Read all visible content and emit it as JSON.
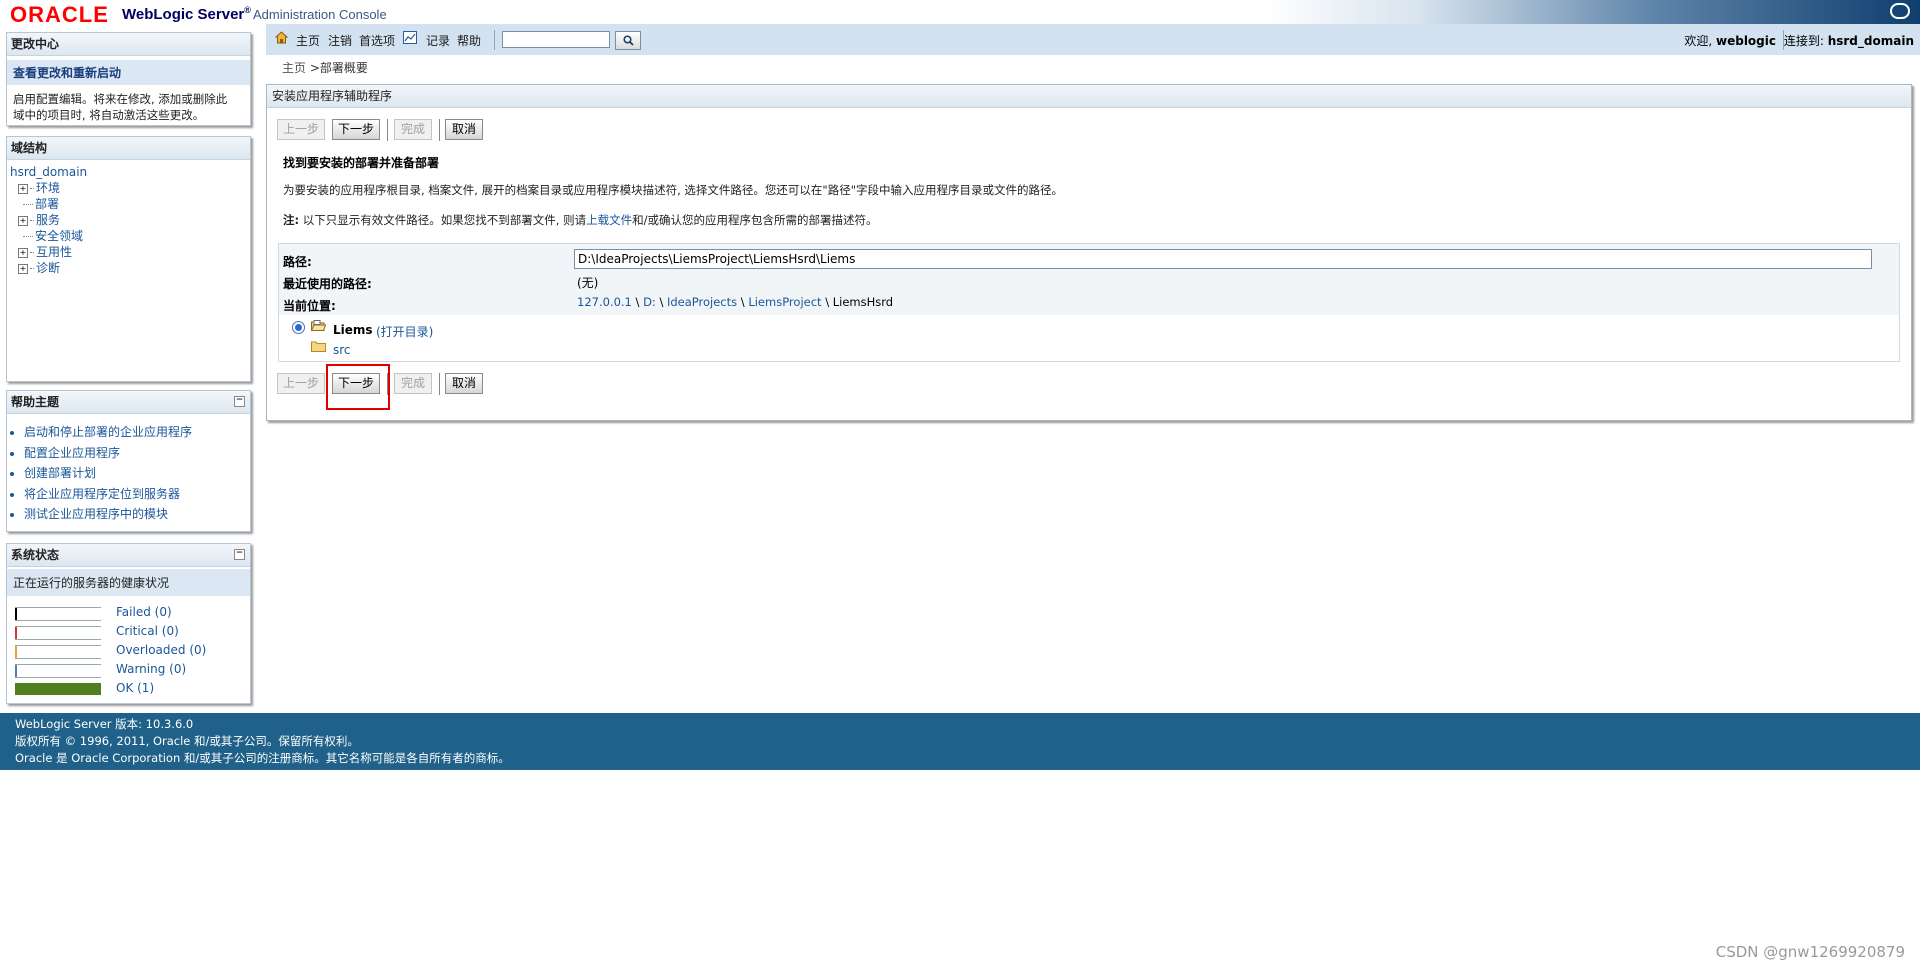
{
  "header": {
    "oracle_logo": "ORACLE",
    "product": "WebLogic Server",
    "product_reg": "®",
    "subtitle": "Administration Console"
  },
  "toolbar": {
    "home": "主页",
    "logout": "注销",
    "preferences": "首选项",
    "record": "记录",
    "help": "帮助",
    "search_value": "",
    "welcome_prefix": "欢迎, ",
    "welcome_user": "weblogic",
    "connected_prefix": "连接到: ",
    "connected_domain": "hsrd_domain"
  },
  "breadcrumb": {
    "home": "主页",
    "sep": " >",
    "current": "部署概要"
  },
  "change_center": {
    "title": "更改中心",
    "link": "查看更改和重新启动",
    "desc_line1": "启用配置编辑。将来在修改, 添加或删除此",
    "desc_line2": "域中的项目时, 将自动激活这些更改。"
  },
  "domain_structure": {
    "title": "域结构",
    "root": "hsrd_domain",
    "items": [
      {
        "label": "环境",
        "expandable": true
      },
      {
        "label": "部署",
        "expandable": false
      },
      {
        "label": "服务",
        "expandable": true
      },
      {
        "label": "安全领域",
        "expandable": false
      },
      {
        "label": "互用性",
        "expandable": true
      },
      {
        "label": "诊断",
        "expandable": true
      }
    ]
  },
  "help_topics": {
    "title": "帮助主题",
    "items": [
      "启动和停止部署的企业应用程序",
      "配置企业应用程序",
      "创建部署计划",
      "将企业应用程序定位到服务器",
      "测试企业应用程序中的模块"
    ]
  },
  "system_status": {
    "title": "系统状态",
    "subtitle": "正在运行的服务器的健康状况",
    "rows": [
      {
        "label": "Failed (0)",
        "color": "#000000",
        "fraction": 0
      },
      {
        "label": "Critical (0)",
        "color": "#e03030",
        "fraction": 0
      },
      {
        "label": "Overloaded (0)",
        "color": "#f0a030",
        "fraction": 0
      },
      {
        "label": "Warning (0)",
        "color": "#5080c0",
        "fraction": 0
      },
      {
        "label": "OK (1)",
        "color": "#4f7f1f",
        "fraction": 1
      }
    ]
  },
  "wizard": {
    "title": "安装应用程序辅助程序",
    "buttons": {
      "back": "上一步",
      "next": "下一步",
      "finish": "完成",
      "cancel": "取消"
    },
    "section_title": "找到要安装的部署并准备部署",
    "description": "为要安装的应用程序根目录, 档案文件, 展开的档案目录或应用程序模块描述符, 选择文件路径。您还可以在\"路径\"字段中输入应用程序目录或文件的路径。",
    "note_label": "注:",
    "note_text_1": " 以下只显示有效文件路径。如果您找不到部署文件, 则请",
    "note_link": "上载文件",
    "note_text_2": "和/或确认您的应用程序包含所需的部署描述符。",
    "path_label": "路径:",
    "path_value": "D:\\IdeaProjects\\LiemsProject\\LiemsHsrd\\Liems",
    "recent_label": "最近使用的路径:",
    "recent_value": "(无)",
    "current_label": "当前位置:",
    "current_location": [
      "127.0.0.1",
      "D:",
      "IdeaProjects",
      "LiemsProject",
      "LiemsHsrd"
    ],
    "entry_name": "Liems",
    "entry_open": "(打开目录)",
    "entry_child": "src"
  },
  "footer": {
    "line1": "WebLogic Server 版本: 10.3.6.0",
    "line2": "版权所有 © 1996, 2011, Oracle 和/或其子公司。保留所有权利。",
    "line3": "Oracle 是 Oracle Corporation 和/或其子公司的注册商标。其它名称可能是各自所有者的商标。"
  },
  "watermark": "CSDN @gnw1269920879"
}
